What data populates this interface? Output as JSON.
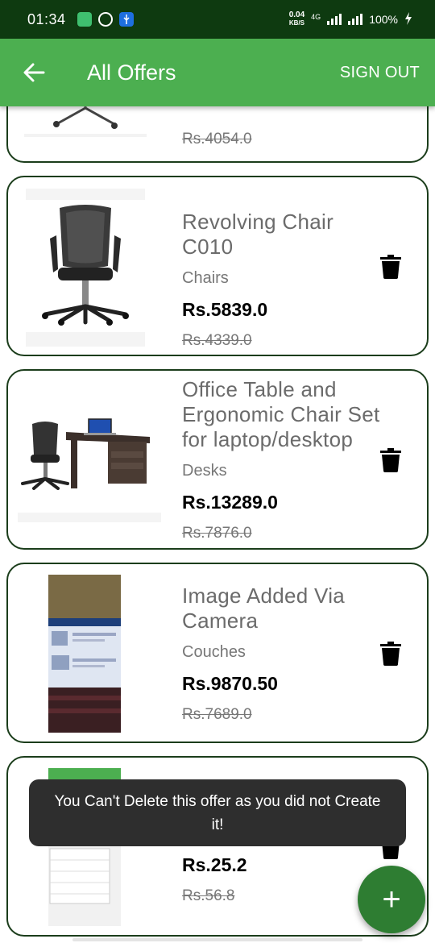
{
  "status_bar": {
    "time": "01:34",
    "net_speed_value": "0.04",
    "net_speed_unit": "KB/S",
    "network_type": "4G",
    "battery": "100%"
  },
  "app_bar": {
    "title": "All Offers",
    "sign_out_label": "SIGN OUT",
    "back_icon": "arrow-left-icon"
  },
  "offers": [
    {
      "name": "",
      "category": "",
      "price": "",
      "old_price": "Rs.4054.0"
    },
    {
      "name": "Revolving Chair C010",
      "category": "Chairs",
      "price": "Rs.5839.0",
      "old_price": "Rs.4339.0"
    },
    {
      "name": "Office Table and Ergonomic Chair Set for laptop/desktop",
      "category": "Desks",
      "price": "Rs.13289.0",
      "old_price": "Rs.7876.0"
    },
    {
      "name": "Image Added Via Camera",
      "category": "Couches",
      "price": "Rs.9870.50",
      "old_price": "Rs.7689.0"
    },
    {
      "name": "",
      "category": "",
      "price": "Rs.25.2",
      "old_price": "Rs.56.8"
    }
  ],
  "toast": {
    "message": "You Can't Delete this offer as you did not Create it!"
  },
  "fab": {
    "label": "+"
  },
  "colors": {
    "app_bar": "#4caf50",
    "status_bar": "#0e3a10",
    "fab": "#2e7d32",
    "card_border": "#1b3d1b"
  }
}
